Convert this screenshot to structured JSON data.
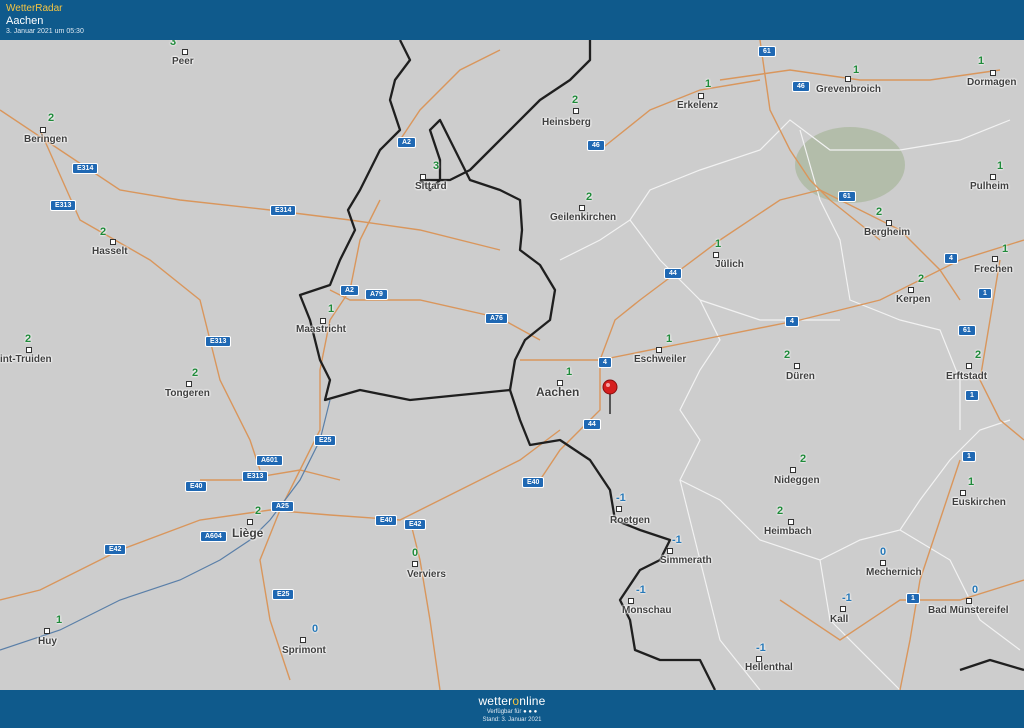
{
  "header": {
    "brand": "WetterRadar",
    "location": "Aachen",
    "timestamp": "3. Januar 2021 um 05:30"
  },
  "footer": {
    "logo_before": "wetter",
    "logo_o": "o",
    "logo_after": "nline",
    "available_label": "Verfügbar für",
    "available_icons": "● ● ●",
    "status": "Stand: 3. Januar 2021"
  },
  "colors": {
    "bar": "#0f5a8c",
    "roads": "#d9965c",
    "border": "#1f1f1f",
    "warm_temp": "#1f8a3a",
    "cold_temp": "#2779b8",
    "shield": "#1f68b3"
  },
  "map": {
    "pin_icon": "red-location-pin-icon",
    "cities": [
      {
        "name": "Peer",
        "temp": "3"
      },
      {
        "name": "Beringen",
        "temp": "2"
      },
      {
        "name": "Hasselt",
        "temp": "2"
      },
      {
        "name": "int-Truiden",
        "temp": "2"
      },
      {
        "name": "Tongeren",
        "temp": "2"
      },
      {
        "name": "Maastricht",
        "temp": "1"
      },
      {
        "name": "Sittard",
        "temp": "3"
      },
      {
        "name": "Heinsberg",
        "temp": "2"
      },
      {
        "name": "Erkelenz",
        "temp": "1"
      },
      {
        "name": "Grevenbroich",
        "temp": "1"
      },
      {
        "name": "Dormagen",
        "temp": "1"
      },
      {
        "name": "Geilenkirchen",
        "temp": "2"
      },
      {
        "name": "Jülich",
        "temp": "1"
      },
      {
        "name": "Bergheim",
        "temp": "2"
      },
      {
        "name": "Pulheim",
        "temp": "1"
      },
      {
        "name": "Frechen",
        "temp": "1"
      },
      {
        "name": "Kerpen",
        "temp": "2"
      },
      {
        "name": "Eschweiler",
        "temp": "1"
      },
      {
        "name": "Aachen",
        "temp": "1"
      },
      {
        "name": "Düren",
        "temp": "2"
      },
      {
        "name": "Erftstadt",
        "temp": "2"
      },
      {
        "name": "Liège",
        "temp": "2"
      },
      {
        "name": "Verviers",
        "temp": "0"
      },
      {
        "name": "Roetgen",
        "temp": "-1"
      },
      {
        "name": "Simmerath",
        "temp": "-1"
      },
      {
        "name": "Nideggen",
        "temp": "2"
      },
      {
        "name": "Heimbach",
        "temp": "2"
      },
      {
        "name": "Euskirchen",
        "temp": "1"
      },
      {
        "name": "Monschau",
        "temp": "-1"
      },
      {
        "name": "Mechernich",
        "temp": "0"
      },
      {
        "name": "Kall",
        "temp": "-1"
      },
      {
        "name": "Bad Münstereifel",
        "temp": "0"
      },
      {
        "name": "Huy",
        "temp": "1"
      },
      {
        "name": "Sprimont",
        "temp": "0"
      },
      {
        "name": "Hellenthal",
        "temp": "-1"
      }
    ],
    "roads": [
      "61",
      "46",
      "A2",
      "46",
      "E314",
      "E313",
      "E314",
      "A2",
      "A79",
      "A76",
      "61",
      "44",
      "4",
      "4",
      "4",
      "E313",
      "61",
      "A601",
      "E313",
      "E25",
      "E40",
      "E40",
      "E42",
      "E40",
      "44",
      "A25",
      "E42",
      "A604",
      "E25",
      "1",
      "1",
      "1",
      "1"
    ]
  }
}
